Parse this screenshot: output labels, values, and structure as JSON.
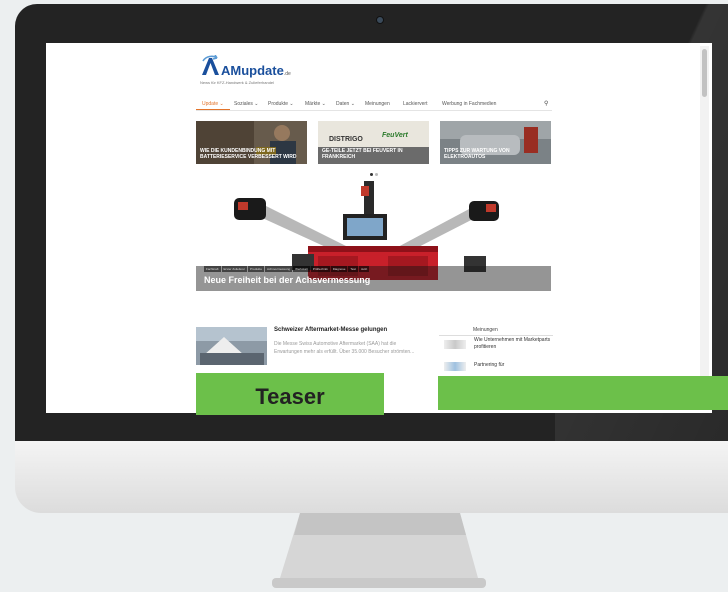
{
  "site": {
    "logo_text": "AMupdate",
    "logo_tld": ".de",
    "tagline": "News für KFZ-Handwerk & Zulieferhandel"
  },
  "nav": {
    "items": [
      {
        "label": "Update ⌄",
        "active": true
      },
      {
        "label": "Soziales ⌄",
        "active": false
      },
      {
        "label": "Produkte ⌄",
        "active": false
      },
      {
        "label": "Märkte ⌄",
        "active": false
      },
      {
        "label": "Daten ⌄",
        "active": false
      },
      {
        "label": "Meinungen",
        "active": false
      },
      {
        "label": "Lackiervert",
        "active": false
      },
      {
        "label": "Werbung in Fachmedien",
        "active": false
      }
    ],
    "search_icon": "search-icon"
  },
  "featured": [
    {
      "title": "Wie die Kundenbindung mit Batterieservice verbessert wird"
    },
    {
      "title": "Ge-Teile jetzt bei Feuvert in Frankreich",
      "brand_left": "DISTRIGO",
      "brand_right": "FeuVert"
    },
    {
      "title": "Tipps zur Wartung von Elektroautos"
    }
  ],
  "slider": {
    "title": "Neue Freiheit bei der Achsvermessung",
    "tags": [
      "Fachkraft",
      "Erster Zulieferer",
      "Produkte",
      "Achsvermessung",
      "Werkstatt",
      "Prüftechnik",
      "Diagnose",
      "Test",
      "Jetzt"
    ],
    "active_dot": 0,
    "dot_count": 2
  },
  "article": {
    "title": "Schweizer Aftermarket-Messe gelungen",
    "excerpt": "Die Messe Swiss Automotive Aftermarket (SAA) hat die Erwartungen mehr als erfüllt. Über 35.000 Besucher strömten..."
  },
  "sidebar": {
    "heading": "Meinungen",
    "items": [
      {
        "text": "Wie Unternehmen mit Marketparts profitieren"
      },
      {
        "text": "Partnering für"
      }
    ]
  },
  "overlay": {
    "teaser_label": "Teaser"
  },
  "colors": {
    "accent_orange": "#e3742b",
    "overlay_green": "#6cc04a",
    "logo_blue": "#1a4f9c",
    "bezel": "#232323"
  }
}
